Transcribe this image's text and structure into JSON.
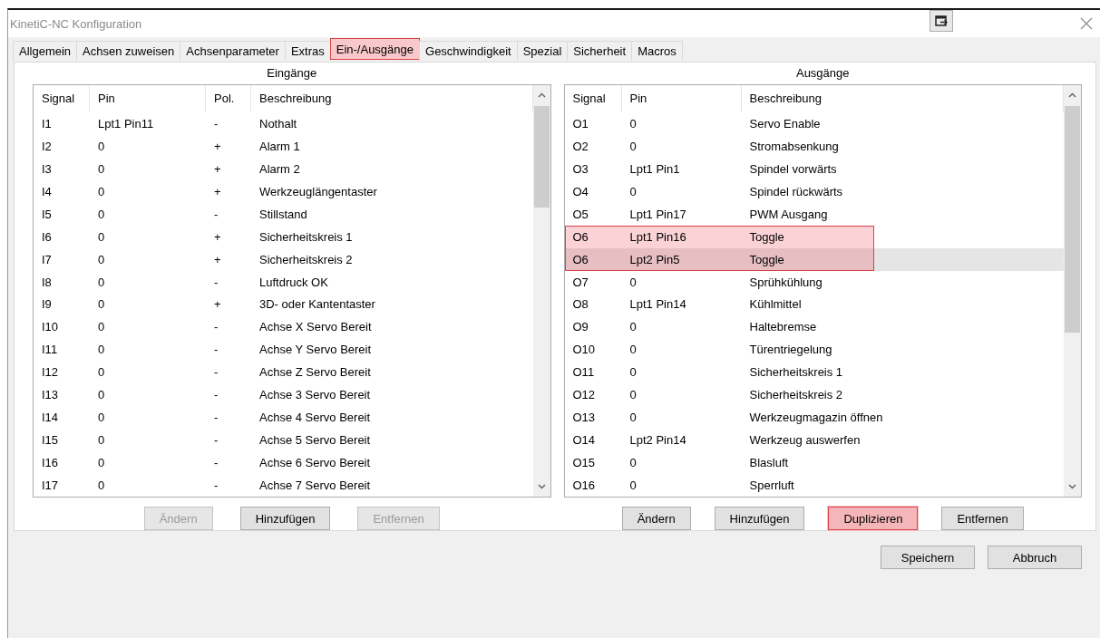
{
  "window": {
    "title": "KinetiC-NC Konfiguration"
  },
  "tabs": [
    {
      "label": "Allgemein",
      "selected": false,
      "highlighted": false
    },
    {
      "label": "Achsen zuweisen",
      "selected": false,
      "highlighted": false
    },
    {
      "label": "Achsenparameter",
      "selected": false,
      "highlighted": false
    },
    {
      "label": "Extras",
      "selected": false,
      "highlighted": false
    },
    {
      "label": "Ein-/Ausgänge",
      "selected": true,
      "highlighted": true
    },
    {
      "label": "Geschwindigkeit",
      "selected": false,
      "highlighted": false
    },
    {
      "label": "Spezial",
      "selected": false,
      "highlighted": false
    },
    {
      "label": "Sicherheit",
      "selected": false,
      "highlighted": false
    },
    {
      "label": "Macros",
      "selected": false,
      "highlighted": false
    }
  ],
  "inputs": {
    "title": "Eingänge",
    "columns": [
      "Signal",
      "Pin",
      "Pol.",
      "Beschreibung"
    ],
    "rows": [
      {
        "cells": [
          "I1",
          "Lpt1 Pin11",
          "-",
          "Nothalt"
        ],
        "selected": false,
        "highlighted": false
      },
      {
        "cells": [
          "I2",
          "0",
          "+",
          "Alarm 1"
        ],
        "selected": false,
        "highlighted": false
      },
      {
        "cells": [
          "I3",
          "0",
          "+",
          "Alarm 2"
        ],
        "selected": false,
        "highlighted": false
      },
      {
        "cells": [
          "I4",
          "0",
          "+",
          "Werkzeuglängentaster"
        ],
        "selected": false,
        "highlighted": false
      },
      {
        "cells": [
          "I5",
          "0",
          "-",
          "Stillstand"
        ],
        "selected": false,
        "highlighted": false
      },
      {
        "cells": [
          "I6",
          "0",
          "+",
          "Sicherheitskreis 1"
        ],
        "selected": false,
        "highlighted": false
      },
      {
        "cells": [
          "I7",
          "0",
          "+",
          "Sicherheitskreis 2"
        ],
        "selected": false,
        "highlighted": false
      },
      {
        "cells": [
          "I8",
          "0",
          "-",
          "Luftdruck OK"
        ],
        "selected": false,
        "highlighted": false
      },
      {
        "cells": [
          "I9",
          "0",
          "+",
          "3D- oder Kantentaster"
        ],
        "selected": false,
        "highlighted": false
      },
      {
        "cells": [
          "I10",
          "0",
          "-",
          "Achse X Servo Bereit"
        ],
        "selected": false,
        "highlighted": false
      },
      {
        "cells": [
          "I11",
          "0",
          "-",
          "Achse Y Servo Bereit"
        ],
        "selected": false,
        "highlighted": false
      },
      {
        "cells": [
          "I12",
          "0",
          "-",
          "Achse Z Servo Bereit"
        ],
        "selected": false,
        "highlighted": false
      },
      {
        "cells": [
          "I13",
          "0",
          "-",
          "Achse 3 Servo Bereit"
        ],
        "selected": false,
        "highlighted": false
      },
      {
        "cells": [
          "I14",
          "0",
          "-",
          "Achse 4 Servo Bereit"
        ],
        "selected": false,
        "highlighted": false
      },
      {
        "cells": [
          "I15",
          "0",
          "-",
          "Achse 5 Servo Bereit"
        ],
        "selected": false,
        "highlighted": false
      },
      {
        "cells": [
          "I16",
          "0",
          "-",
          "Achse 6 Servo Bereit"
        ],
        "selected": false,
        "highlighted": false
      },
      {
        "cells": [
          "I17",
          "0",
          "-",
          "Achse 7 Servo Bereit"
        ],
        "selected": false,
        "highlighted": false
      }
    ],
    "buttons": [
      {
        "label": "Ändern",
        "disabled": true,
        "highlighted": false
      },
      {
        "label": "Hinzufügen",
        "disabled": false,
        "highlighted": false
      },
      {
        "label": "Entfernen",
        "disabled": true,
        "highlighted": false
      }
    ]
  },
  "outputs": {
    "title": "Ausgänge",
    "columns": [
      "Signal",
      "Pin",
      "Beschreibung"
    ],
    "rows": [
      {
        "cells": [
          "O1",
          "0",
          "Servo Enable"
        ],
        "selected": false,
        "highlighted": false
      },
      {
        "cells": [
          "O2",
          "0",
          "Stromabsenkung"
        ],
        "selected": false,
        "highlighted": false
      },
      {
        "cells": [
          "O3",
          "Lpt1 Pin1",
          "Spindel vorwärts"
        ],
        "selected": false,
        "highlighted": false
      },
      {
        "cells": [
          "O4",
          "0",
          "Spindel rückwärts"
        ],
        "selected": false,
        "highlighted": false
      },
      {
        "cells": [
          "O5",
          "Lpt1 Pin17",
          "PWM Ausgang"
        ],
        "selected": false,
        "highlighted": false
      },
      {
        "cells": [
          "O6",
          "Lpt1 Pin16",
          "Toggle"
        ],
        "selected": false,
        "highlighted": true
      },
      {
        "cells": [
          "O6",
          "Lpt2 Pin5",
          "Toggle"
        ],
        "selected": true,
        "highlighted": true
      },
      {
        "cells": [
          "O7",
          "0",
          "Sprühkühlung"
        ],
        "selected": false,
        "highlighted": false
      },
      {
        "cells": [
          "O8",
          "Lpt1 Pin14",
          "Kühlmittel"
        ],
        "selected": false,
        "highlighted": false
      },
      {
        "cells": [
          "O9",
          "0",
          "Haltebremse"
        ],
        "selected": false,
        "highlighted": false
      },
      {
        "cells": [
          "O10",
          "0",
          "Türentriegelung"
        ],
        "selected": false,
        "highlighted": false
      },
      {
        "cells": [
          "O11",
          "0",
          "Sicherheitskreis 1"
        ],
        "selected": false,
        "highlighted": false
      },
      {
        "cells": [
          "O12",
          "0",
          "Sicherheitskreis 2"
        ],
        "selected": false,
        "highlighted": false
      },
      {
        "cells": [
          "O13",
          "0",
          "Werkzeugmagazin öffnen"
        ],
        "selected": false,
        "highlighted": false
      },
      {
        "cells": [
          "O14",
          "Lpt2 Pin14",
          "Werkzeug auswerfen"
        ],
        "selected": false,
        "highlighted": false
      },
      {
        "cells": [
          "O15",
          "0",
          "Blasluft"
        ],
        "selected": false,
        "highlighted": false
      },
      {
        "cells": [
          "O16",
          "0",
          "Sperrluft"
        ],
        "selected": false,
        "highlighted": false
      }
    ],
    "buttons": [
      {
        "label": "Ändern",
        "disabled": false,
        "highlighted": false
      },
      {
        "label": "Hinzufügen",
        "disabled": false,
        "highlighted": false
      },
      {
        "label": "Duplizieren",
        "disabled": false,
        "highlighted": true
      },
      {
        "label": "Entfernen",
        "disabled": false,
        "highlighted": false
      }
    ]
  },
  "footer_buttons": [
    {
      "label": "Speichern",
      "disabled": false,
      "highlighted": false
    },
    {
      "label": "Abbruch",
      "disabled": false,
      "highlighted": false
    }
  ]
}
